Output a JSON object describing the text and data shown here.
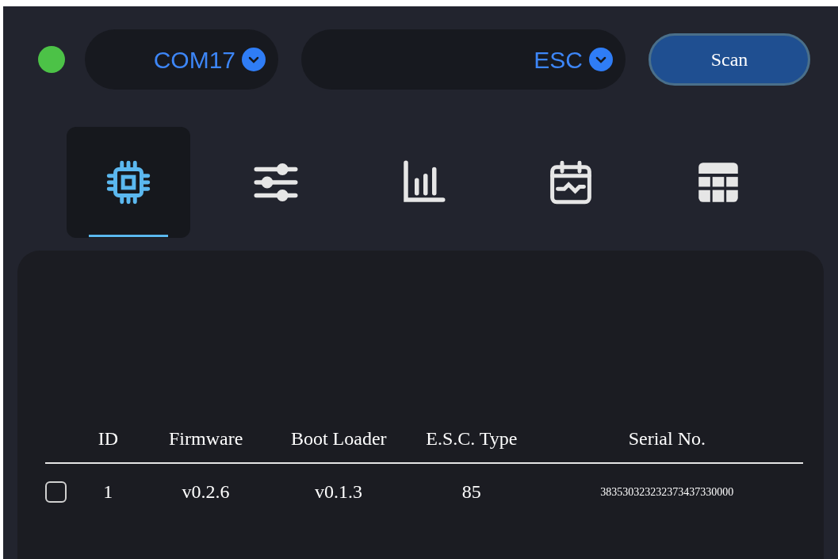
{
  "status": {
    "connected": true
  },
  "port_select": {
    "value": "COM17"
  },
  "device_select": {
    "value": "ESC"
  },
  "scan_button": {
    "label": "Scan"
  },
  "tabs": [
    {
      "kind": "chip",
      "selected": true
    },
    {
      "kind": "sliders",
      "selected": false
    },
    {
      "kind": "bars",
      "selected": false
    },
    {
      "kind": "calendar",
      "selected": false
    },
    {
      "kind": "grid",
      "selected": false
    }
  ],
  "table": {
    "columns": [
      "ID",
      "Firmware",
      "Boot Loader",
      "E.S.C. Type",
      "Serial No."
    ],
    "rows": [
      {
        "checked": false,
        "cells": [
          "1",
          "v0.2.6",
          "v0.1.3",
          "85",
          "383530323232373437330000"
        ]
      }
    ]
  }
}
